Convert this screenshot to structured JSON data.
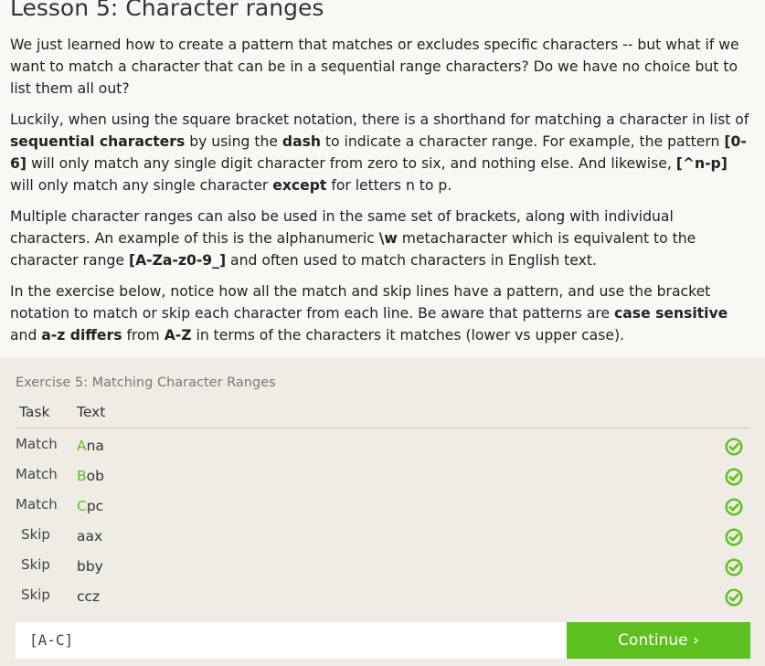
{
  "lesson": {
    "title": "Lesson 5: Character ranges",
    "p1": "We just learned how to create a pattern that matches or excludes specific characters -- but what if we want to match a character that can be in a sequential range characters? Do we have no choice but to list them all out?",
    "p2": [
      {
        "t": "Luckily, when using the square bracket notation, there is a shorthand for matching a character in list of ",
        "b": false
      },
      {
        "t": "sequential characters",
        "b": true
      },
      {
        "t": " by using the ",
        "b": false
      },
      {
        "t": "dash",
        "b": true
      },
      {
        "t": " to indicate a character range. For example, the pattern ",
        "b": false
      },
      {
        "t": "[0-6]",
        "b": true
      },
      {
        "t": " will only match any single digit character from zero to six, and nothing else. And likewise, ",
        "b": false
      },
      {
        "t": "[^n-p]",
        "b": true
      },
      {
        "t": " will only match any single character ",
        "b": false
      },
      {
        "t": "except",
        "b": true
      },
      {
        "t": " for letters n to p.",
        "b": false
      }
    ],
    "p3": [
      {
        "t": "Multiple character ranges can also be used in the same set of brackets, along with individual characters. An example of this is the alphanumeric ",
        "b": false
      },
      {
        "t": "\\w",
        "b": true
      },
      {
        "t": " metacharacter which is equivalent to the character range ",
        "b": false
      },
      {
        "t": "[A-Za-z0-9_]",
        "b": true
      },
      {
        "t": " and often used to match characters in English text.",
        "b": false
      }
    ],
    "p4": [
      {
        "t": "In the exercise below, notice how all the match and skip lines have a pattern, and use the bracket notation to match or skip each character from each line. Be aware that patterns are ",
        "b": false
      },
      {
        "t": "case sensitive",
        "b": true
      },
      {
        "t": " and ",
        "b": false
      },
      {
        "t": "a-z differs",
        "b": true
      },
      {
        "t": " from ",
        "b": false
      },
      {
        "t": "A-Z",
        "b": true
      },
      {
        "t": " in terms of the characters it matches (lower vs upper case).",
        "b": false
      }
    ]
  },
  "exercise": {
    "title": "Exercise 5: Matching Character Ranges",
    "header_task": "Task",
    "header_text": "Text",
    "rows": [
      {
        "task": "Match",
        "highlight": "A",
        "rest": "na",
        "status": "check-icon"
      },
      {
        "task": "Match",
        "highlight": "B",
        "rest": "ob",
        "status": "check-icon"
      },
      {
        "task": "Match",
        "highlight": "C",
        "rest": "pc",
        "status": "check-icon"
      },
      {
        "task": "Skip",
        "highlight": "",
        "rest": "aax",
        "status": "check-icon"
      },
      {
        "task": "Skip",
        "highlight": "",
        "rest": "bby",
        "status": "check-icon"
      },
      {
        "task": "Skip",
        "highlight": "",
        "rest": "ccz",
        "status": "check-icon"
      }
    ],
    "input_value": "[A-C]",
    "continue_label": "Continue ›"
  },
  "colors": {
    "accent": "#5ec01e",
    "highlight": "#5cbf1f",
    "check": "#5ec01e"
  }
}
